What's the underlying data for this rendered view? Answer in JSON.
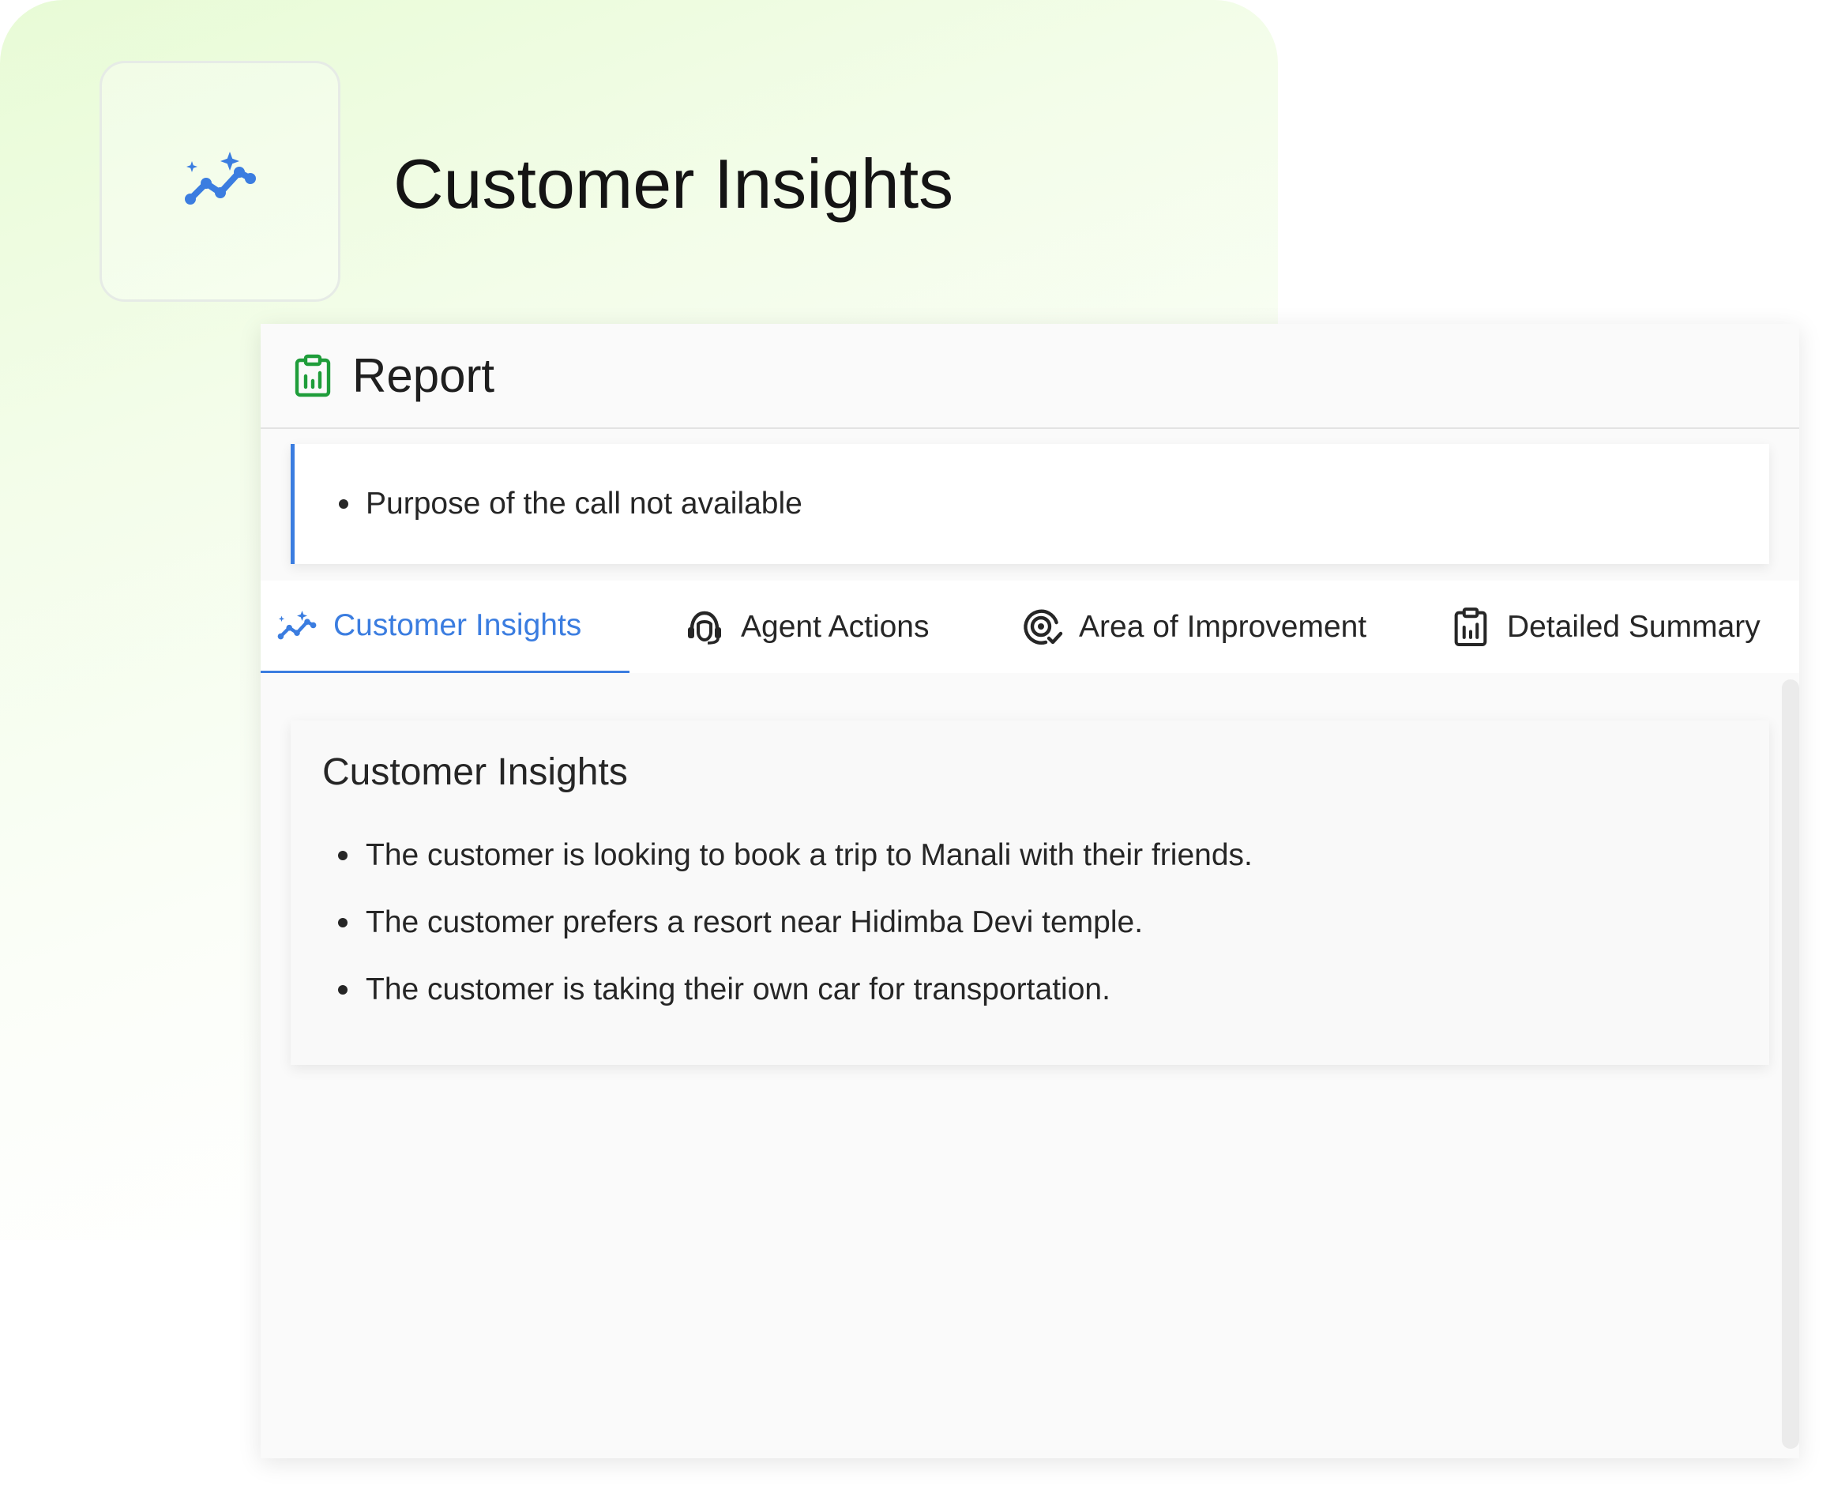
{
  "hero": {
    "title": "Customer Insights",
    "logo_icon": "sparkle-trend-icon"
  },
  "report": {
    "title": "Report",
    "icon": "clipboard-chart-icon",
    "purpose_items": [
      "Purpose of the call not available"
    ]
  },
  "tabs": [
    {
      "label": "Customer Insights",
      "icon": "sparkle-trend-icon",
      "active": true
    },
    {
      "label": "Agent Actions",
      "icon": "headset-agent-icon",
      "active": false
    },
    {
      "label": "Area of Improvement",
      "icon": "target-check-icon",
      "active": false
    },
    {
      "label": "Detailed Summary",
      "icon": "clipboard-chart-icon",
      "active": false
    }
  ],
  "insights": {
    "title": "Customer Insights",
    "items": [
      "The customer is looking to book a trip to Manali with their friends.",
      "The customer prefers a resort near Hidimba Devi temple.",
      "The customer is taking their own car for transportation."
    ]
  },
  "colors": {
    "accent": "#3b7de0",
    "report_icon": "#1f9d3a",
    "text": "#262626",
    "gradient_green": "#e8fbd6"
  }
}
